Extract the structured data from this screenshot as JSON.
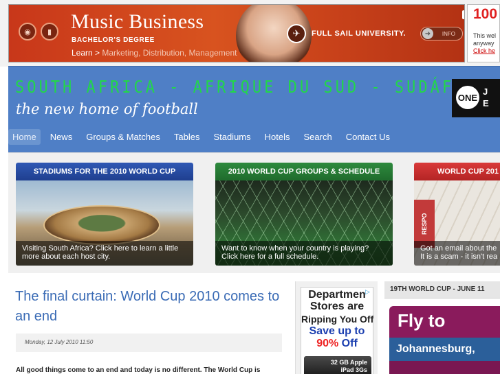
{
  "banner_ad": {
    "title": "Music Business",
    "subtitle": "BACHELOR'S DEGREE",
    "tag_prefix": "Learn >",
    "tag_rest": "Marketing, Distribution, Management",
    "brand": "FULL SAIL UNIVERSITY.",
    "info_label": "INFO",
    "icons": [
      "vinyl-icon",
      "equalizer-icon"
    ]
  },
  "side_ad": {
    "title": "100",
    "line1": "This wel",
    "line2": "anyway",
    "link": "Click he"
  },
  "header": {
    "site_title": "SOUTH AFRICA - AFRIQUE DU SUD - SUDÁFRICA",
    "subtitle": "the new home of football",
    "badge_logo": "ONE",
    "badge_text_1": "J",
    "badge_text_2": "E"
  },
  "nav": {
    "items": [
      "Home",
      "News",
      "Groups & Matches",
      "Tables",
      "Stadiums",
      "Hotels",
      "Search",
      "Contact Us"
    ],
    "active": "Home"
  },
  "features": [
    {
      "heading": "STADIUMS FOR THE 2010 WORLD CUP",
      "caption_1": "Visiting South Africa? Click here to learn a little",
      "caption_2": "more about each host city."
    },
    {
      "heading": "2010 WORLD CUP GROUPS & SCHEDULE",
      "caption_1": "Want to know when your country is playing?",
      "caption_2": "Click here for a full schedule."
    },
    {
      "heading": "WORLD CUP 201",
      "caption_1": "Got an email about the",
      "caption_2": "It is a scam - it isn't rea",
      "ticket_text": "RESPO"
    }
  ],
  "article": {
    "title": "The final curtain: World Cup 2010 comes to an end",
    "date": "Monday, 12 July 2010 11:50",
    "body": "All good things come to an end and today is no different. The World Cup is"
  },
  "mid_ad": {
    "line1": "Departmen",
    "line2": "Stores are",
    "line3": "Ripping You Off",
    "line4": "Save up to",
    "line5_pct": "90%",
    "line5_rest": " Off",
    "product_1": "32 GB Apple",
    "product_2": "iPad 3Gs"
  },
  "right_col": {
    "heading": "19TH WORLD CUP - JUNE 11",
    "fly_title": "Fly to",
    "fly_dest": "Johannesburg,"
  }
}
